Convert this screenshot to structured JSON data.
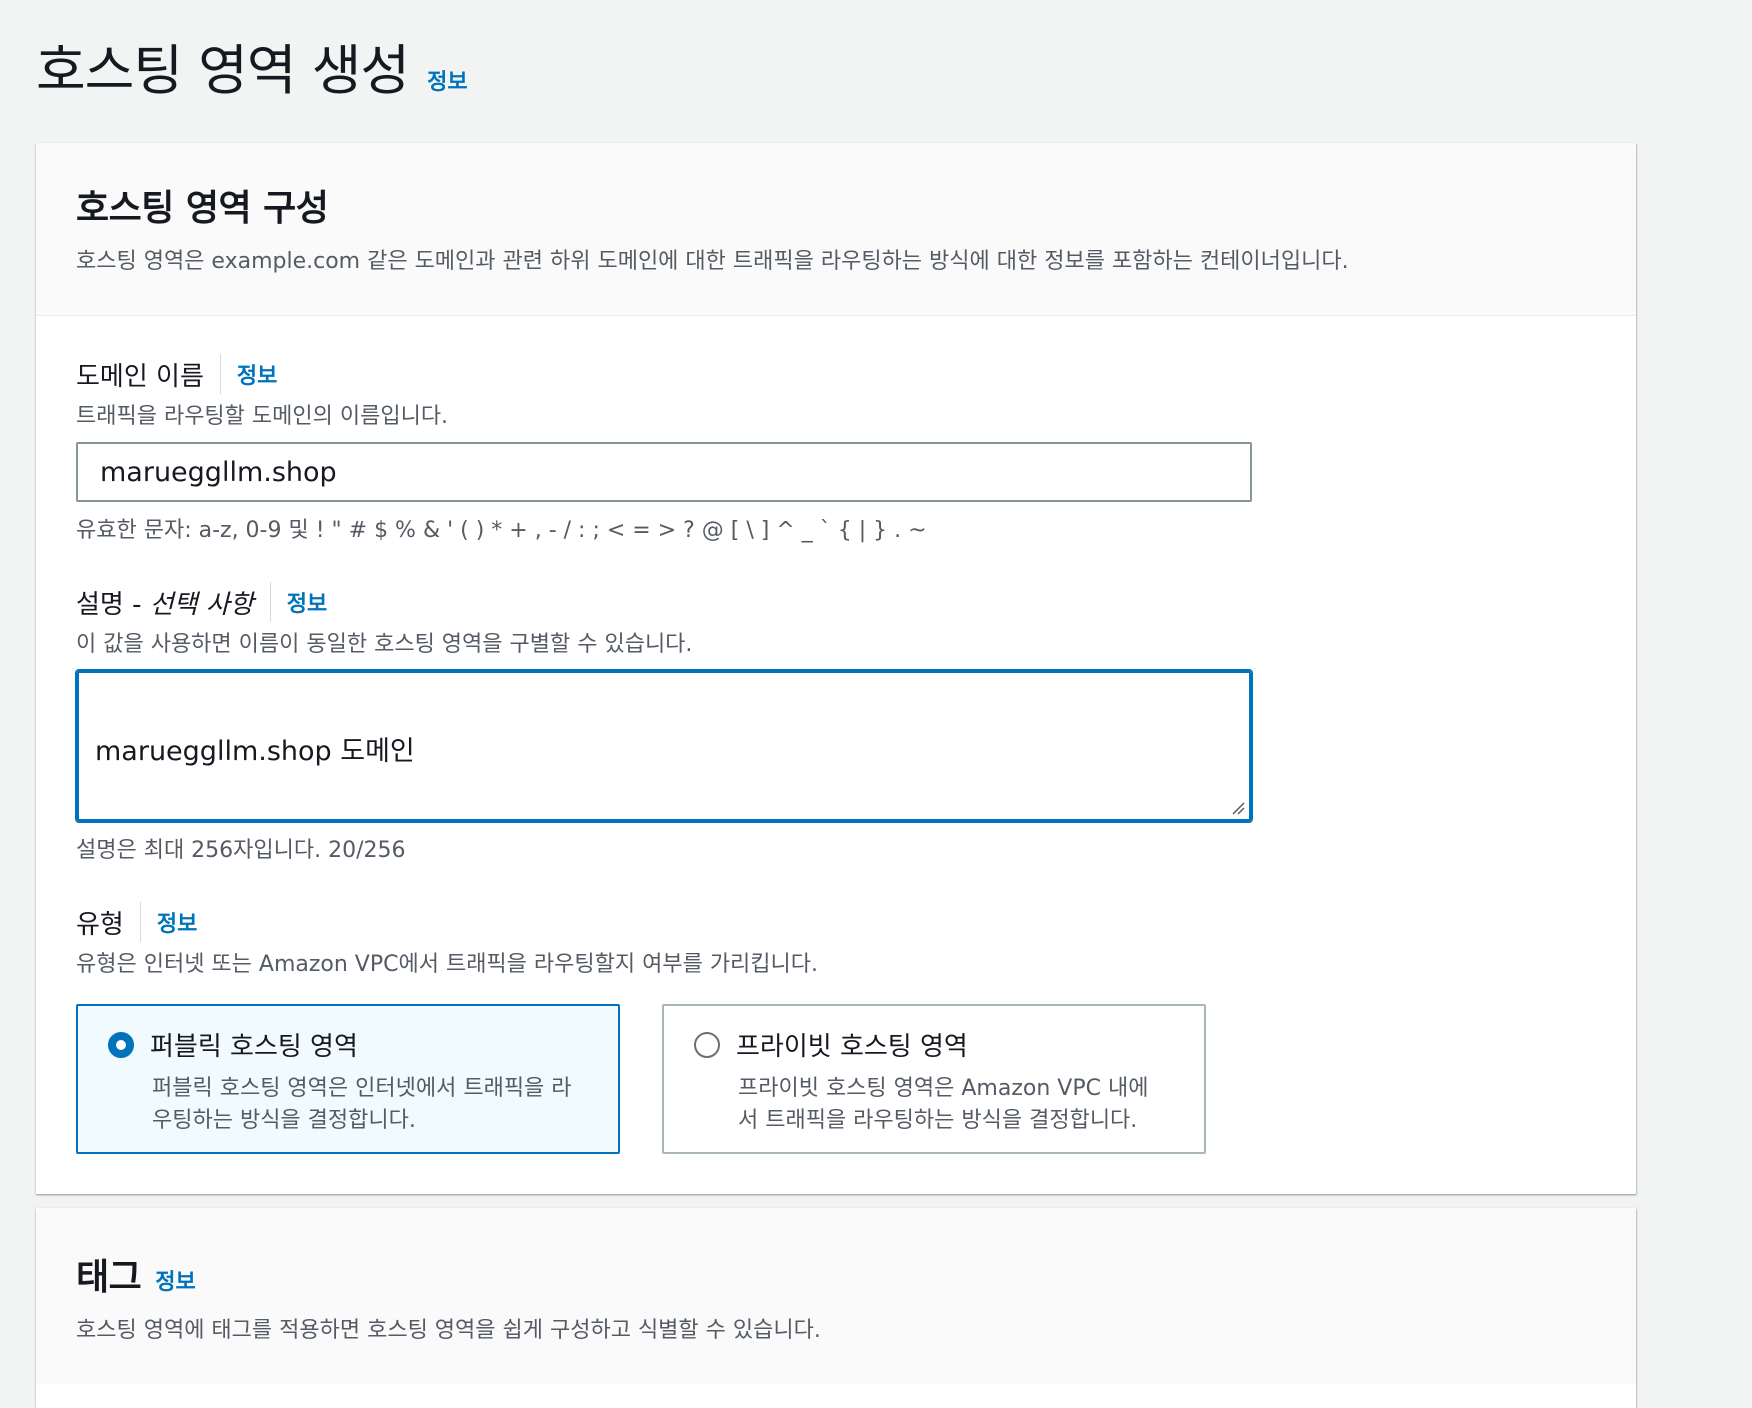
{
  "page": {
    "title": "호스팅 영역 생성",
    "info": "정보"
  },
  "config_card": {
    "title": "호스팅 영역 구성",
    "description": "호스팅 영역은 example.com 같은 도메인과 관련 하위 도메인에 대한 트래픽을 라우팅하는 방식에 대한 정보를 포함하는 컨테이너입니다."
  },
  "domain": {
    "label": "도메인 이름",
    "info": "정보",
    "description": "트래픽을 라우팅할 도메인의 이름입니다.",
    "value": "marueggllm.shop",
    "constraint": "유효한 문자: a-z, 0-9 및 ! \" # $ % & ' ( ) * + , - / : ; < = > ? @ [ \\ ] ^ _ ` { | } . ~"
  },
  "comment": {
    "label": "설명 - ",
    "label_optional": "선택 사항",
    "info": "정보",
    "description": "이 값을 사용하면 이름이 동일한 호스팅 영역을 구별할 수 있습니다.",
    "value": "marueggllm.shop 도메인",
    "constraint": "설명은 최대 256자입니다. 20/256"
  },
  "type": {
    "label": "유형",
    "info": "정보",
    "description": "유형은 인터넷 또는 Amazon VPC에서 트래픽을 라우팅할지 여부를 가리킵니다.",
    "options": [
      {
        "label": "퍼블릭 호스팅 영역",
        "line1": "퍼블릭 호스팅 영역은 인터넷에서 트래픽을 라",
        "line2": "우팅하는 방식을 결정합니다.",
        "selected": true
      },
      {
        "label": "프라이빗 호스팅 영역",
        "line1": "프라이빗 호스팅 영역은 Amazon VPC 내에",
        "line2": "서 트래픽을 라우팅하는 방식을 결정합니다.",
        "selected": false
      }
    ]
  },
  "tags_card": {
    "title": "태그",
    "info": "정보",
    "description": "호스팅 영역에 태그를 적용하면 호스팅 영역을 쉽게 구성하고 식별할 수 있습니다."
  },
  "colors": {
    "accent": "#0073bb",
    "background": "#f2f3f3",
    "text": "#16191f",
    "secondary_text": "#545b64"
  }
}
